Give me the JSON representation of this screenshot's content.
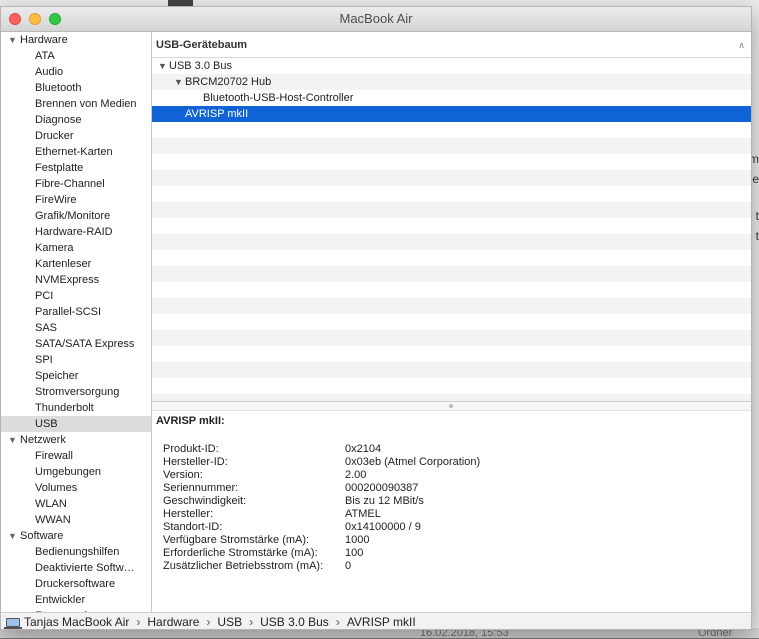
{
  "window": {
    "title": "MacBook Air"
  },
  "sidebar": {
    "categories": [
      {
        "label": "Hardware",
        "items": [
          "ATA",
          "Audio",
          "Bluetooth",
          "Brennen von Medien",
          "Diagnose",
          "Drucker",
          "Ethernet-Karten",
          "Festplatte",
          "Fibre-Channel",
          "FireWire",
          "Grafik/Monitore",
          "Hardware-RAID",
          "Kamera",
          "Kartenleser",
          "NVMExpress",
          "PCI",
          "Parallel-SCSI",
          "SAS",
          "SATA/SATA Express",
          "SPI",
          "Speicher",
          "Stromversorgung",
          "Thunderbolt",
          "USB"
        ]
      },
      {
        "label": "Netzwerk",
        "items": [
          "Firewall",
          "Umgebungen",
          "Volumes",
          "WLAN",
          "WWAN"
        ]
      },
      {
        "label": "Software",
        "items": [
          "Bedienungshilfen",
          "Deaktivierte Softw…",
          "Druckersoftware",
          "Entwickler",
          "Framework"
        ]
      }
    ],
    "selected": "USB"
  },
  "tree": {
    "header": "USB-Gerätebaum",
    "nodes": [
      {
        "label": "USB 3.0 Bus",
        "level": 0,
        "expanded": true,
        "selected": false
      },
      {
        "label": "BRCM20702 Hub",
        "level": 1,
        "expanded": true,
        "selected": false
      },
      {
        "label": "Bluetooth-USB-Host-Controller",
        "level": 2,
        "expanded": false,
        "selected": false
      },
      {
        "label": "AVRISP mkII",
        "level": 1,
        "expanded": false,
        "selected": true
      }
    ]
  },
  "detail": {
    "title": "AVRISP mkII:",
    "rows": [
      {
        "key": "Produkt-ID:",
        "value": "0x2104"
      },
      {
        "key": "Hersteller-ID:",
        "value": "0x03eb  (Atmel Corporation)"
      },
      {
        "key": "Version:",
        "value": "2.00"
      },
      {
        "key": "Seriennummer:",
        "value": "000200090387"
      },
      {
        "key": "Geschwindigkeit:",
        "value": "Bis zu 12 MBit/s"
      },
      {
        "key": "Hersteller:",
        "value": "ATMEL"
      },
      {
        "key": "Standort-ID:",
        "value": "0x14100000 / 9"
      },
      {
        "key": "Verfügbare Stromstärke (mA):",
        "value": "1000"
      },
      {
        "key": "Erforderliche Stromstärke (mA):",
        "value": "100"
      },
      {
        "key": "Zusätzlicher Betriebsstrom (mA):",
        "value": "0"
      }
    ]
  },
  "pathbar": {
    "icon": "laptop-icon",
    "segments": [
      "Tanjas MacBook Air",
      "Hardware",
      "USB",
      "USB 3.0 Bus",
      "AVRISP mkII"
    ],
    "separator": "›"
  },
  "background": {
    "peek_letters": [
      "m",
      "de",
      "t",
      "t"
    ],
    "date": "16.02.2018, 15:53",
    "folder": "Ordner"
  },
  "colors": {
    "selection": "#1063d6",
    "sidebar_selection": "#dcdcdc"
  }
}
